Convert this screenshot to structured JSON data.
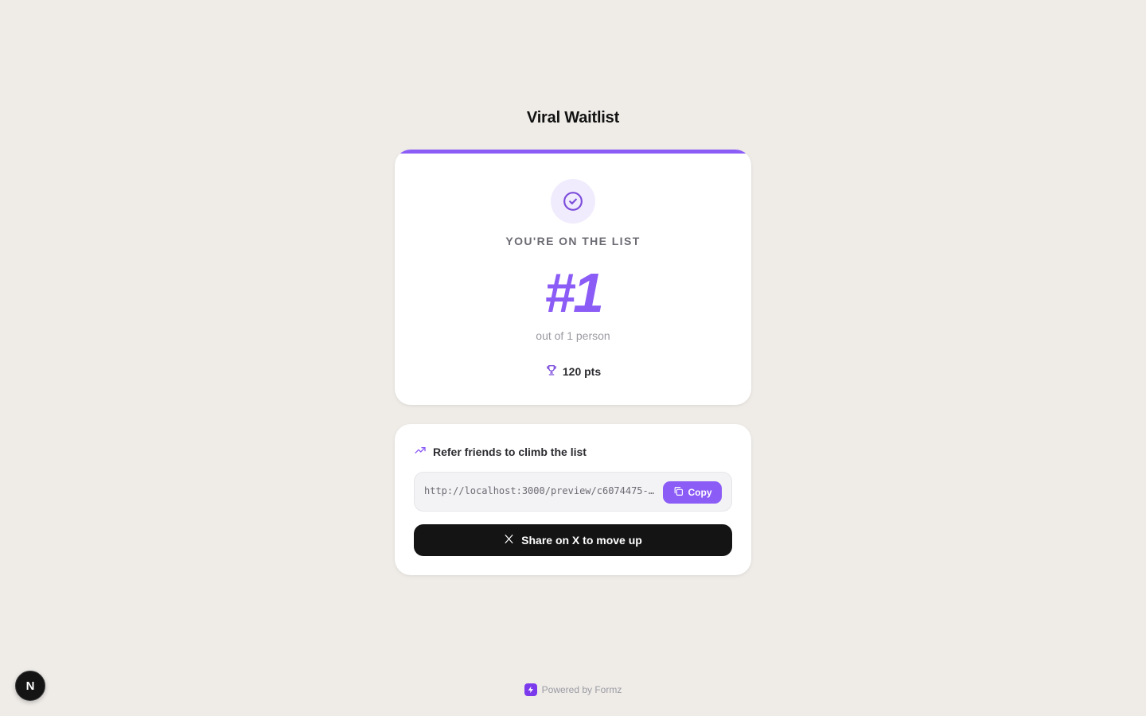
{
  "page": {
    "title": "Viral Waitlist"
  },
  "status": {
    "label": "YOU'RE ON THE LIST",
    "rank": "#1",
    "total": "out of 1 person",
    "points": "120 pts"
  },
  "referral": {
    "heading": "Refer friends to climb the list",
    "link": "http://localhost:3000/preview/c6074475-…",
    "copy_label": "Copy",
    "share_label": "Share on X to move up"
  },
  "footer": {
    "powered_by": "Powered by Formz"
  },
  "dev_badge": {
    "letter": "N"
  },
  "colors": {
    "accent": "#8b5cf6",
    "background": "#efece8",
    "dark_button": "#141414"
  },
  "icons": {
    "status": "check-circle-icon",
    "points": "trophy-icon",
    "referral": "trending-up-icon",
    "copy": "copy-icon",
    "share": "x-logo-icon",
    "footer": "formz-logo-icon"
  }
}
